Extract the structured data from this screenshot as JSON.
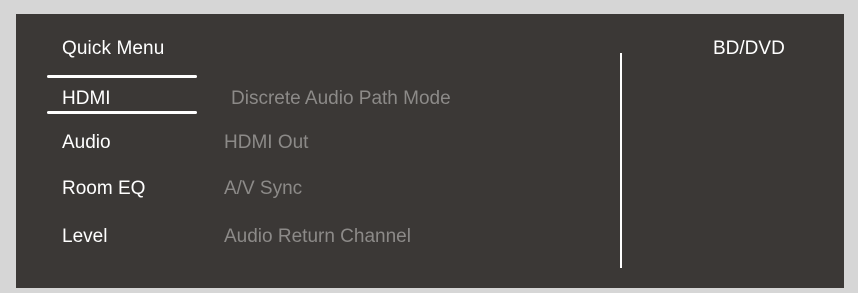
{
  "menu": {
    "title": "Quick Menu",
    "source": "BD/DVD",
    "categories": [
      {
        "label": "HDMI",
        "selected": true
      },
      {
        "label": "Audio",
        "selected": false
      },
      {
        "label": "Room EQ",
        "selected": false
      },
      {
        "label": "Level",
        "selected": false
      }
    ],
    "options": [
      {
        "label": "Discrete Audio Path Mode"
      },
      {
        "label": "HDMI Out"
      },
      {
        "label": "A/V Sync"
      },
      {
        "label": "Audio Return Channel"
      }
    ]
  },
  "colors": {
    "panel_bg": "#3b3836",
    "frame_bg": "#d6d6d6",
    "text_primary": "#ffffff",
    "text_muted": "#8c8a88"
  }
}
